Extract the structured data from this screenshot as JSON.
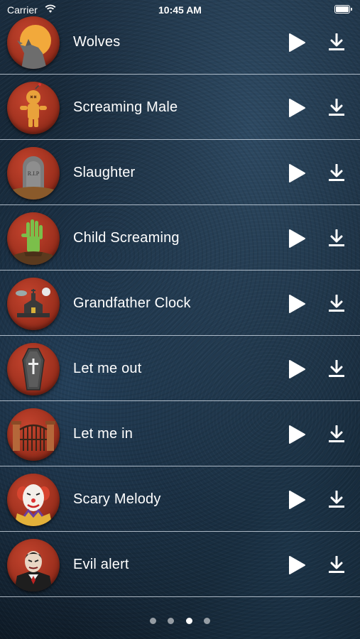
{
  "status_bar": {
    "carrier": "Carrier",
    "time": "10:45 AM"
  },
  "sounds": [
    {
      "label": "Wolves",
      "icon": "wolf-icon"
    },
    {
      "label": "Screaming Male",
      "icon": "voodoo-doll-icon"
    },
    {
      "label": "Slaughter",
      "icon": "tombstone-icon"
    },
    {
      "label": "Child Screaming",
      "icon": "zombie-hand-icon"
    },
    {
      "label": "Grandfather Clock",
      "icon": "haunted-house-icon"
    },
    {
      "label": "Let me out",
      "icon": "coffin-icon"
    },
    {
      "label": "Let me in",
      "icon": "cemetery-gate-icon"
    },
    {
      "label": "Scary Melody",
      "icon": "clown-icon"
    },
    {
      "label": "Evil alert",
      "icon": "vampire-icon"
    }
  ],
  "tombstone_text": "R.I.P",
  "page_indicator": {
    "count": 4,
    "active_index": 2
  },
  "colors": {
    "accent_red": "#b33a24",
    "separator": "#dce6f0",
    "text": "#ffffff"
  }
}
